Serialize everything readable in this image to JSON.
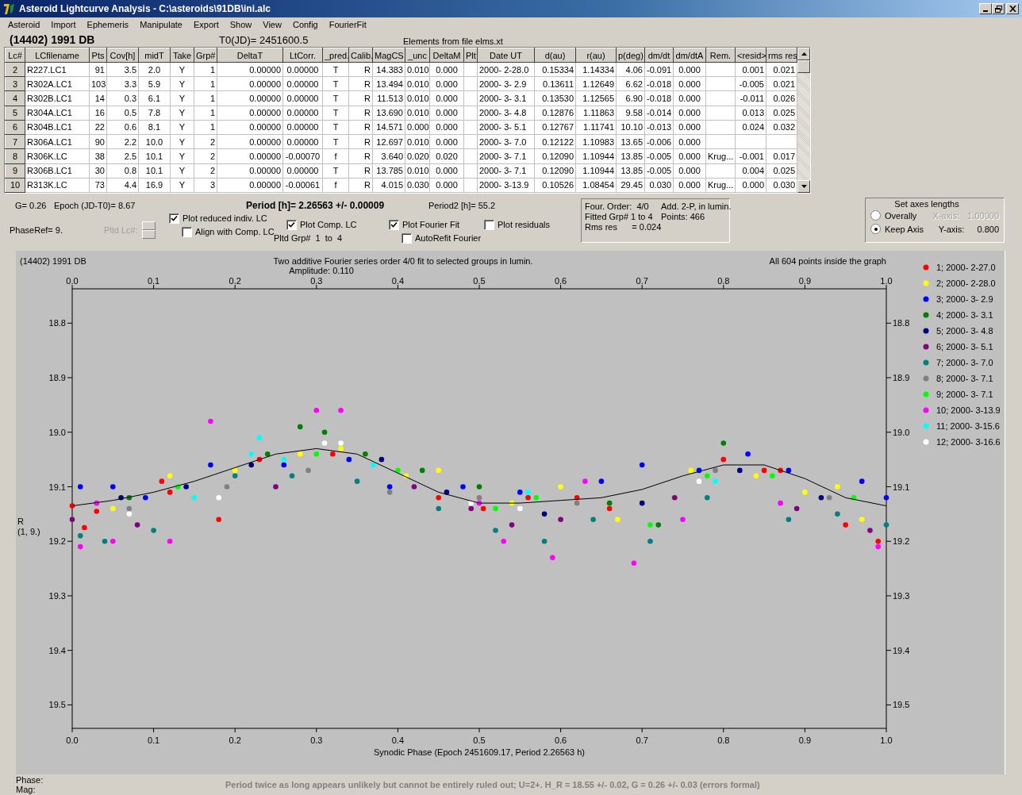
{
  "window": {
    "title": "Asteroid Lightcurve Analysis - C:\\asteroids\\91DB\\ini.alc"
  },
  "menu": [
    "Asteroid",
    "Import",
    "Ephemeris",
    "Manipulate",
    "Export",
    "Show",
    "View",
    "Config",
    "FourierFit"
  ],
  "header": {
    "object": "(14402) 1991 DB",
    "t0": "T0(JD)= 2451600.5",
    "elements": "Elements from file elms.xt"
  },
  "table": {
    "columns": [
      "Lc#",
      "LCfilename",
      "Pts",
      "Cov[h]",
      "midT",
      "Take",
      "Grp#",
      "DeltaT",
      "LtCorr.",
      "_pred.",
      "Calib.",
      "MagCS",
      "_unc",
      "DeltaM",
      "Plt",
      "Date UT",
      "d(au)",
      "r(au)",
      "p(deg)",
      "dm/dt",
      "dm/dtA",
      "Rem.",
      "<resid>",
      "rms res"
    ],
    "rows": [
      {
        "cells": [
          "2",
          "R227.LC1",
          "91",
          "3.5",
          "2.0",
          "Y",
          "1",
          "0.00000",
          "0.00000",
          "T",
          "R",
          "14.383",
          "0.010",
          "0.000",
          null,
          "2000- 2-28.0",
          "0.15334",
          "1.14334",
          "4.06",
          "-0.091",
          "0.000",
          null,
          "0.001",
          "0.021"
        ]
      },
      {
        "cells": [
          "3",
          "R302A.LC1",
          "103",
          "3.3",
          "5.9",
          "Y",
          "1",
          "0.00000",
          "0.00000",
          "T",
          "R",
          "13.494",
          "0.010",
          "0.000",
          null,
          "2000- 3- 2.9",
          "0.13611",
          "1.12649",
          "6.62",
          "-0.018",
          "0.000",
          null,
          "-0.005",
          "0.021"
        ]
      },
      {
        "cells": [
          "4",
          "R302B.LC1",
          "14",
          "0.3",
          "6.1",
          "Y",
          "1",
          "0.00000",
          "0.00000",
          "T",
          "R",
          "11.513",
          "0.010",
          "0.000",
          null,
          "2000- 3- 3.1",
          "0.13530",
          "1.12565",
          "6.90",
          "-0.018",
          "0.000",
          null,
          "-0.011",
          "0.026"
        ]
      },
      {
        "cells": [
          "5",
          "R304A.LC1",
          "16",
          "0.5",
          "7.8",
          "Y",
          "1",
          "0.00000",
          "0.00000",
          "T",
          "R",
          "13.690",
          "0.010",
          "0.000",
          null,
          "2000- 3- 4.8",
          "0.12876",
          "1.11863",
          "9.58",
          "-0.014",
          "0.000",
          null,
          "0.013",
          "0.025"
        ]
      },
      {
        "cells": [
          "6",
          "R304B.LC1",
          "22",
          "0.6",
          "8.1",
          "Y",
          "1",
          "0.00000",
          "0.00000",
          "T",
          "R",
          "14.571",
          "0.000",
          "0.000",
          null,
          "2000- 3- 5.1",
          "0.12767",
          "1.11741",
          "10.10",
          "-0.013",
          "0.000",
          null,
          "0.024",
          "0.032"
        ]
      },
      {
        "cells": [
          "7",
          "R306A.LC1",
          "90",
          "2.2",
          "10.0",
          "Y",
          "2",
          "0.00000",
          "0.00000",
          "T",
          "R",
          "12.697",
          "0.010",
          "0.000",
          null,
          "2000- 3- 7.0",
          "0.12122",
          "1.10983",
          "13.65",
          "-0.006",
          "0.000",
          null,
          null,
          null
        ]
      },
      {
        "cells": [
          "8",
          "R306K.LC",
          "38",
          "2.5",
          "10.1",
          "Y",
          "2",
          "0.00000",
          "-0.00070",
          "f",
          "R",
          "3.640",
          "0.020",
          "0.020",
          null,
          "2000- 3- 7.1",
          "0.12090",
          "1.10944",
          "13.85",
          "-0.005",
          "0.000",
          "Krug...",
          "-0.001",
          "0.017"
        ]
      },
      {
        "cells": [
          "9",
          "R306B.LC1",
          "30",
          "0.8",
          "10.1",
          "Y",
          "2",
          "0.00000",
          "0.00000",
          "T",
          "R",
          "13.785",
          "0.010",
          "0.000",
          null,
          "2000- 3- 7.1",
          "0.12090",
          "1.10944",
          "13.85",
          "-0.005",
          "0.000",
          null,
          "0.004",
          "0.025"
        ]
      },
      {
        "cells": [
          "10",
          "R313K.LC",
          "73",
          "4.4",
          "16.9",
          "Y",
          "3",
          "0.00000",
          "-0.00061",
          "f",
          "R",
          "4.015",
          "0.030",
          "0.000",
          null,
          "2000- 3-13.9",
          "0.10526",
          "1.08454",
          "29.45",
          "0.030",
          "0.000",
          "Krug...",
          "0.000",
          "0.030"
        ]
      }
    ]
  },
  "info": {
    "g": "G= 0.26",
    "epoch": "Epoch (JD-T0)= 8.67",
    "period": "Period [h]= 2.26563 +/- 0.00009",
    "period2": "Period2 [h]= 55.2",
    "phase_ref": "PhaseRef= 9.",
    "pltd_lc": "Pltd Lc#:",
    "pltd_grp": "Pltd Grp#  1  to  4"
  },
  "checks": {
    "plot_reduced": {
      "label": "Plot reduced indiv. LC",
      "checked": true
    },
    "align": {
      "label": "Align with Comp. LC",
      "checked": false
    },
    "plot_comp": {
      "label": "Plot Comp. LC",
      "checked": true
    },
    "plot_fourier": {
      "label": "Plot Fourier Fit",
      "checked": true
    },
    "autorefit": {
      "label": "AutoRefit Fourier",
      "checked": false
    },
    "plot_residuals": {
      "label": "Plot residuals",
      "checked": false
    }
  },
  "fit_info": [
    "Four. Order:  4/0",
    "Add. 2-P, in lumin.",
    "Fitted Grp# 1 to 4",
    "Points: 466",
    "Rms res      = 0.024"
  ],
  "axes": {
    "title": "Set axes lengths",
    "options": [
      {
        "label": "Overally",
        "selected": false,
        "axis_label": "X-axis:",
        "axis_value": "1.00000",
        "disabled": true
      },
      {
        "label": "Keep Axis",
        "selected": true,
        "axis_label": "Y-axis:",
        "axis_value": "0.800",
        "disabled": false
      }
    ]
  },
  "plot": {
    "object": "(14402) 1991 DB",
    "subtitle": "Two additive Fourier series order 4/0 fit to selected groups in lumin.",
    "amplitude": "Amplitude: 0.110",
    "points_note": "All 604 points inside the graph",
    "chart_data": {
      "type": "scatter",
      "xlabel": "Synodic Phase (Epoch 2451609.17, Period 2.26563 h)",
      "ylabel": "R\n(1, 9.)",
      "xlim": [
        0,
        1
      ],
      "ylim": [
        19.543,
        18.737
      ],
      "legend": "right",
      "xticks": [
        {
          "value": 0,
          "label": "0.0"
        },
        {
          "value": 0.1,
          "label": "0.1"
        },
        {
          "value": 0.2,
          "label": "0.2"
        },
        {
          "value": 0.3,
          "label": "0.3"
        },
        {
          "value": 0.4,
          "label": "0.4"
        },
        {
          "value": 0.5,
          "label": "0.5"
        },
        {
          "value": 0.6,
          "label": "0.6"
        },
        {
          "value": 0.7,
          "label": "0.7"
        },
        {
          "value": 0.8,
          "label": "0.8"
        },
        {
          "value": 0.9,
          "label": "0.9"
        },
        {
          "value": 1,
          "label": "1.0"
        }
      ],
      "yticks": [
        {
          "value": 18.8,
          "label": "18.8"
        },
        {
          "value": 18.9,
          "label": "18.9"
        },
        {
          "value": 19,
          "label": "19.0"
        },
        {
          "value": 19.1,
          "label": "19.1"
        },
        {
          "value": 19.2,
          "label": "19.2"
        },
        {
          "value": 19.3,
          "label": "19.3"
        },
        {
          "value": 19.4,
          "label": "19.4"
        },
        {
          "value": 19.5,
          "label": "19.5"
        }
      ],
      "series": [
        {
          "name": "1; 2000- 2-27.0",
          "color": "#ff0000",
          "x": [
            0.0,
            0.015,
            0.03,
            0.11,
            0.12,
            0.18,
            0.23,
            0.32,
            0.45,
            0.505,
            0.56,
            0.62,
            0.66,
            0.8,
            0.85,
            0.87,
            0.95,
            0.99
          ],
          "values": [
            19.135,
            19.175,
            19.145,
            19.09,
            19.11,
            19.16,
            19.05,
            19.04,
            19.12,
            19.14,
            19.12,
            19.12,
            19.14,
            19.05,
            19.07,
            19.07,
            19.17,
            19.2
          ]
        },
        {
          "name": "2; 2000- 2-28.0",
          "color": "#ffff00",
          "x": [
            0.05,
            0.12,
            0.2,
            0.28,
            0.33,
            0.41,
            0.45,
            0.54,
            0.6,
            0.67,
            0.76,
            0.84,
            0.9,
            0.94,
            0.97
          ],
          "values": [
            19.14,
            19.08,
            19.07,
            19.04,
            19.03,
            19.08,
            19.07,
            19.13,
            19.1,
            19.16,
            19.07,
            19.08,
            19.11,
            19.1,
            19.16
          ]
        },
        {
          "name": "3; 2000- 3- 2.9",
          "color": "#0000ff",
          "x": [
            0.01,
            0.05,
            0.09,
            0.17,
            0.26,
            0.34,
            0.39,
            0.48,
            0.55,
            0.65,
            0.7,
            0.77,
            0.83,
            0.88,
            0.97,
            1.0
          ],
          "values": [
            19.1,
            19.1,
            19.12,
            19.06,
            19.06,
            19.05,
            19.1,
            19.1,
            19.11,
            19.09,
            19.06,
            19.07,
            19.04,
            19.07,
            19.09,
            19.12
          ]
        },
        {
          "name": "4; 2000- 3- 3.1",
          "color": "#008000",
          "x": [
            0.07,
            0.24,
            0.28,
            0.31,
            0.36,
            0.43,
            0.5,
            0.66,
            0.72,
            0.8
          ],
          "values": [
            19.12,
            19.04,
            18.99,
            19.0,
            19.04,
            19.07,
            19.1,
            19.13,
            19.17,
            19.02
          ]
        },
        {
          "name": "5; 2000- 3- 4.8",
          "color": "#000080",
          "x": [
            0.06,
            0.14,
            0.22,
            0.38,
            0.46,
            0.58,
            0.7,
            0.82,
            0.92
          ],
          "values": [
            19.12,
            19.1,
            19.06,
            19.05,
            19.11,
            19.15,
            19.13,
            19.07,
            19.12
          ]
        },
        {
          "name": "6; 2000- 3- 5.1",
          "color": "#800080",
          "x": [
            0.0,
            0.08,
            0.25,
            0.42,
            0.49,
            0.54,
            0.6,
            0.74,
            0.89,
            0.98
          ],
          "values": [
            19.16,
            19.17,
            19.1,
            19.1,
            19.14,
            19.17,
            19.16,
            19.12,
            19.14,
            19.18
          ]
        },
        {
          "name": "7; 2000- 3- 7.0",
          "color": "#008080",
          "x": [
            0.01,
            0.04,
            0.1,
            0.2,
            0.27,
            0.35,
            0.45,
            0.52,
            0.58,
            0.64,
            0.71,
            0.78,
            0.88,
            0.94,
            1.0
          ],
          "values": [
            19.19,
            19.2,
            19.18,
            19.08,
            19.08,
            19.09,
            19.14,
            19.18,
            19.2,
            19.16,
            19.2,
            19.12,
            19.16,
            19.15,
            19.17
          ]
        },
        {
          "name": "8; 2000- 3- 7.1",
          "color": "#808080",
          "x": [
            0.07,
            0.19,
            0.29,
            0.39,
            0.5,
            0.62,
            0.79,
            0.93
          ],
          "values": [
            19.14,
            19.1,
            19.07,
            19.11,
            19.12,
            19.13,
            19.07,
            19.12
          ]
        },
        {
          "name": "9; 2000- 3- 7.1",
          "color": "#00ff00",
          "x": [
            0.13,
            0.3,
            0.4,
            0.52,
            0.57,
            0.71,
            0.78,
            0.86,
            0.96
          ],
          "values": [
            19.1,
            19.04,
            19.07,
            19.14,
            19.12,
            19.17,
            19.08,
            19.08,
            19.12
          ]
        },
        {
          "name": "10; 2000- 3-13.9",
          "color": "#ff00ff",
          "x": [
            0.01,
            0.03,
            0.05,
            0.12,
            0.17,
            0.3,
            0.33,
            0.5,
            0.53,
            0.59,
            0.63,
            0.69,
            0.75,
            0.87,
            0.99
          ],
          "values": [
            19.21,
            19.13,
            19.2,
            19.2,
            18.98,
            18.96,
            18.96,
            19.13,
            19.2,
            19.23,
            19.09,
            19.24,
            19.16,
            19.13,
            19.21
          ]
        },
        {
          "name": "11; 2000- 3-15.6",
          "color": "#00ffff",
          "x": [
            0.15,
            0.22,
            0.23,
            0.26,
            0.37,
            0.56,
            0.79
          ],
          "values": [
            19.12,
            19.04,
            19.01,
            19.05,
            19.06,
            19.11,
            19.09
          ]
        },
        {
          "name": "12; 2000- 3-16.6",
          "color": "#ffffff",
          "x": [
            0.07,
            0.18,
            0.31,
            0.33,
            0.49,
            0.55,
            0.77
          ],
          "values": [
            19.15,
            19.12,
            19.02,
            19.02,
            19.13,
            19.14,
            19.09
          ]
        },
        {
          "type": "line",
          "color": "#000000",
          "x": [
            0,
            0.05,
            0.1,
            0.15,
            0.2,
            0.25,
            0.3,
            0.35,
            0.4,
            0.45,
            0.5,
            0.55,
            0.6,
            0.65,
            0.7,
            0.75,
            0.8,
            0.85,
            0.9,
            0.95,
            1
          ],
          "values": [
            19.135,
            19.125,
            19.11,
            19.09,
            19.065,
            19.04,
            19.03,
            19.04,
            19.075,
            19.11,
            19.13,
            19.13,
            19.125,
            19.12,
            19.105,
            19.08,
            19.06,
            19.06,
            19.085,
            19.12,
            19.135
          ]
        }
      ]
    }
  },
  "status": {
    "phase": "Phase:",
    "mag": "Mag:",
    "message": "Period twice as long appears unlikely but cannot be entirely ruled out; U=2+. H_R = 18.55 +/- 0.02, G = 0.26 +/- 0.03 (errors formal)"
  }
}
